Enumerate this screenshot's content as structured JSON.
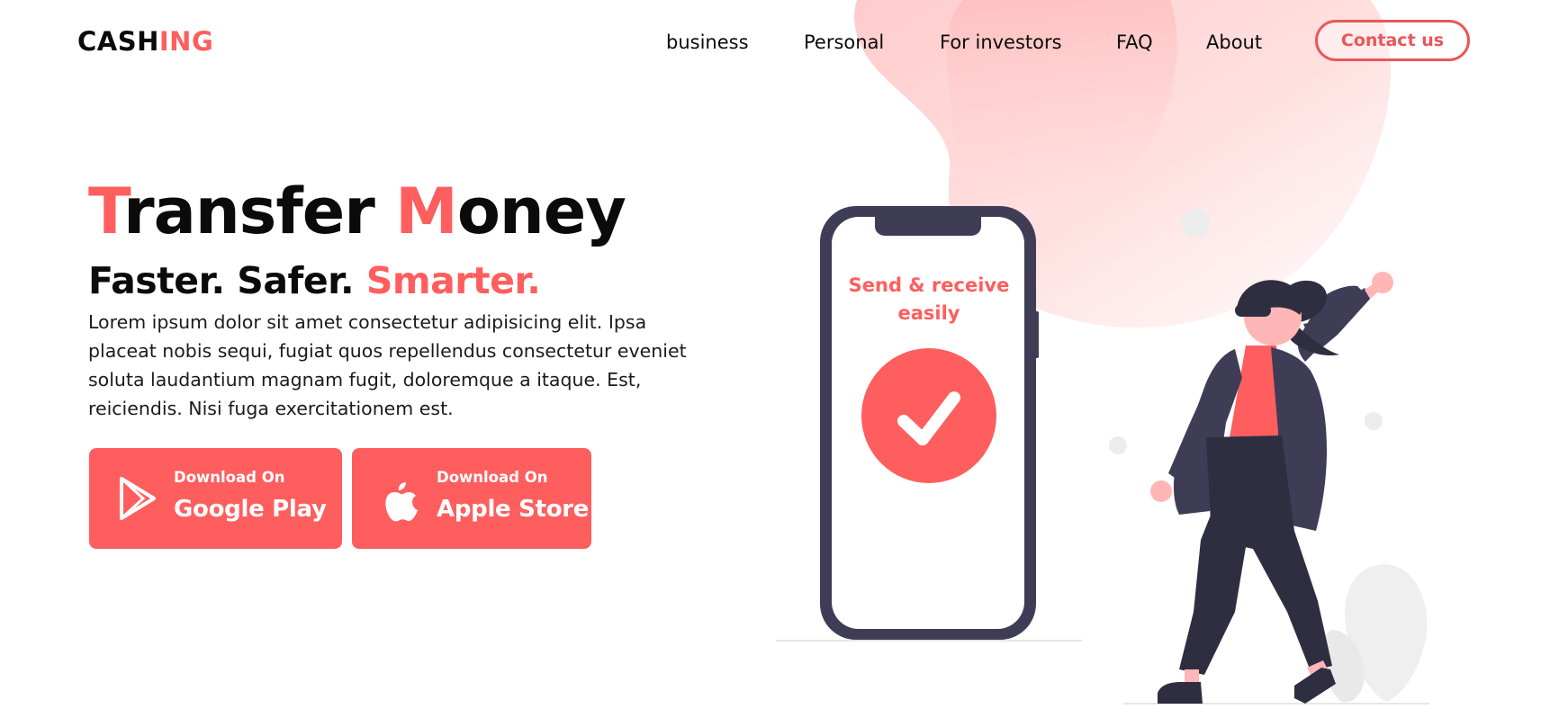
{
  "header": {
    "logo": {
      "dark": "CASH",
      "accent": "ING"
    },
    "nav": [
      {
        "id": "business",
        "label": "business"
      },
      {
        "id": "personal",
        "label": "Personal"
      },
      {
        "id": "investors",
        "label": "For investors"
      },
      {
        "id": "faq",
        "label": "FAQ"
      },
      {
        "id": "about",
        "label": "About"
      }
    ],
    "contact_label": "Contact us"
  },
  "hero": {
    "title": {
      "t_letter": "T",
      "t_rest": "ransfer ",
      "m_letter": "M",
      "m_rest": "oney"
    },
    "subtitle": {
      "part1": "Faster. Safer. ",
      "part2": "Smarter."
    },
    "paragraph": "Lorem ipsum dolor sit amet consectetur adipisicing elit. Ipsa placeat nobis sequi, fugiat quos repellendus consectetur eveniet soluta laudantium magnam fugit, doloremque a itaque. Est, reiciendis. Nisi fuga exercitationem est."
  },
  "store_buttons": {
    "google": {
      "small": "Download On",
      "big": "Google Play",
      "icon": "google-play-icon"
    },
    "apple": {
      "small": "Download On",
      "big": "Apple Store",
      "icon": "apple-icon"
    }
  },
  "illustration": {
    "phone_text_line1": "Send & receive",
    "phone_text_line2": "easily",
    "icon": "checkmark-icon"
  },
  "colors": {
    "accent": "#ff5e5e",
    "contact_border": "#e9575b",
    "dark": "#3f3d56",
    "text": "#0b0b0b"
  }
}
